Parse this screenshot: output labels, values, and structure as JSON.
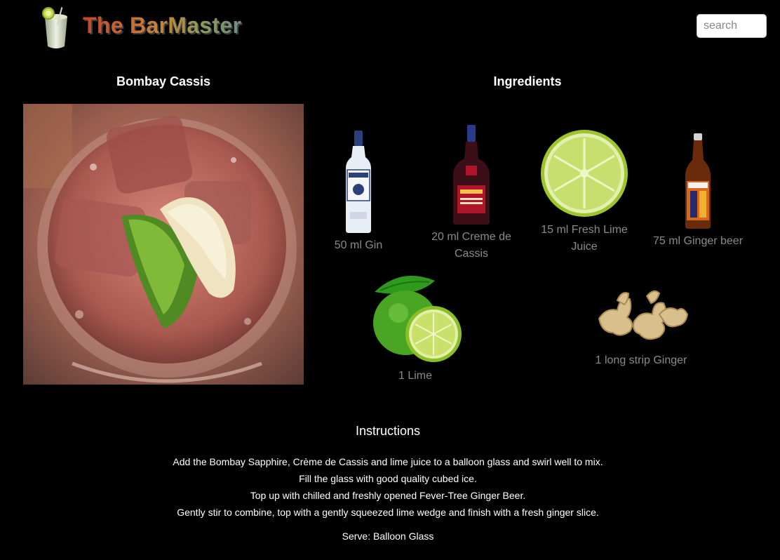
{
  "header": {
    "brand": "The BarMaster",
    "search_placeholder": "search"
  },
  "drink": {
    "name": "Bombay Cassis"
  },
  "ingredients": {
    "title": "Ingredients",
    "items": [
      {
        "label": "50 ml Gin",
        "icon": "gin-bottle-icon"
      },
      {
        "label": "20 ml Creme de Cassis",
        "icon": "creme-de-cassis-bottle-icon"
      },
      {
        "label": "15 ml Fresh Lime Juice",
        "icon": "lime-slice-icon"
      },
      {
        "label": "75 ml Ginger beer",
        "icon": "ginger-beer-bottle-icon"
      },
      {
        "label": "1 Lime",
        "icon": "lime-icon"
      },
      {
        "label": "1 long strip Ginger",
        "icon": "ginger-root-icon"
      }
    ]
  },
  "instructions": {
    "title": "Instructions",
    "lines": [
      "Add the Bombay Sapphire, Crème de Cassis and lime juice to a balloon glass and swirl well to mix.",
      "Fill the glass with good quality cubed ice.",
      "Top up with chilled and freshly opened Fever-Tree Ginger Beer.",
      "Gently stir to combine, top with a gently squeezed lime wedge and finish with a fresh ginger slice."
    ],
    "serve": "Serve: Balloon Glass"
  }
}
